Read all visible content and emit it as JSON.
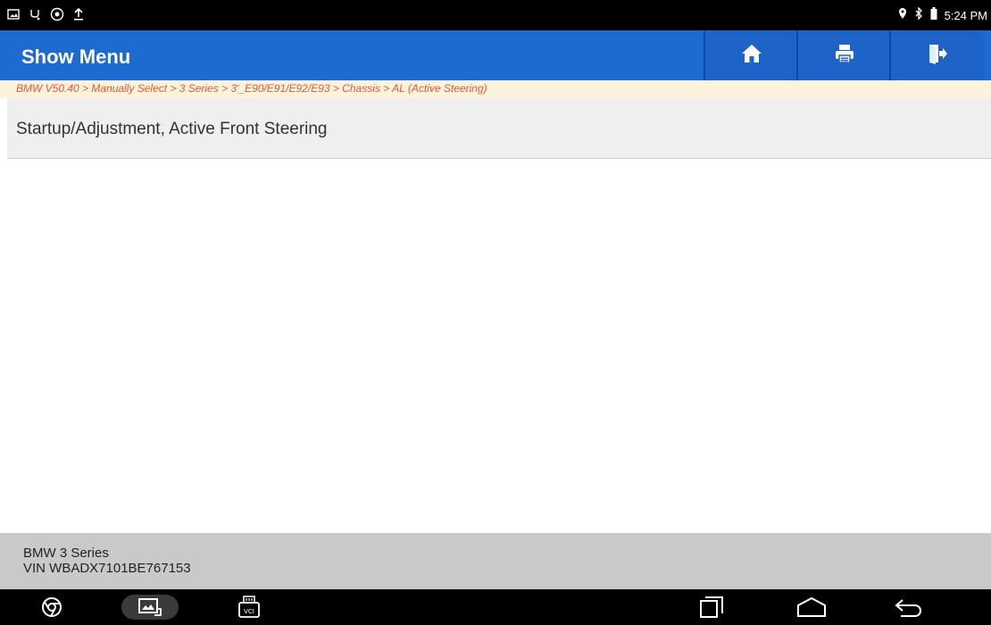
{
  "status_bar": {
    "time": "5:24 PM"
  },
  "header": {
    "title": "Show Menu",
    "buttons": [
      "home-icon",
      "print-icon",
      "exit-icon"
    ]
  },
  "breadcrumb": {
    "text": "BMW V50.40 > Manually Select > 3 Series > 3'_E90/E91/E92/E93 > Chassis > AL (Active Steering)"
  },
  "menu": {
    "items": [
      {
        "label": "Startup/Adjustment, Active Front Steering"
      }
    ]
  },
  "vehicle": {
    "model": "BMW 3 Series",
    "vin": "VIN WBADX7101BE767153"
  },
  "nav_bar": {
    "icons": [
      "chrome-icon",
      "gallery-icon",
      "vci-icon",
      "recents-icon",
      "home-icon",
      "back-icon"
    ]
  },
  "colors": {
    "header": "#1d6ad0",
    "breadcrumb_text": "#e25a35",
    "breadcrumb_bg": "#fdf3dd",
    "menu_bg": "#efefef",
    "vehicle_bg": "#c9c9c9"
  }
}
